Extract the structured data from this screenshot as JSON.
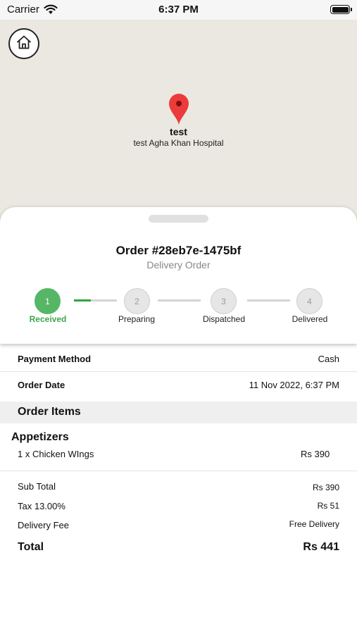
{
  "status_bar": {
    "carrier": "Carrier",
    "time": "6:37 PM"
  },
  "map": {
    "pin_title": "test",
    "pin_subtitle": "test Agha Khan Hospital",
    "pin_color": "#ec3b3b"
  },
  "order": {
    "title": "Order  #28eb7e-1475bf",
    "type": "Delivery Order"
  },
  "steps": [
    {
      "number": "1",
      "label": "Received",
      "done": true
    },
    {
      "number": "2",
      "label": "Preparing",
      "done": false
    },
    {
      "number": "3",
      "label": "Dispatched",
      "done": false
    },
    {
      "number": "4",
      "label": "Delivered",
      "done": false
    }
  ],
  "accent_color": "#55b766",
  "details": {
    "payment_label": "Payment Method",
    "payment_value": "Cash",
    "date_label": "Order Date",
    "date_value": "11 Nov 2022, 6:37 PM"
  },
  "items_section": {
    "title": "Order Items",
    "category": "Appetizers",
    "items": [
      {
        "name": "1 x Chicken WIngs",
        "price": "Rs 390"
      }
    ]
  },
  "summary": {
    "subtotal_label": "Sub Total",
    "subtotal_value": "Rs 390",
    "tax_label": "Tax 13.00%",
    "tax_value": "Rs 51",
    "delivery_label": "Delivery Fee",
    "delivery_value": "Free Delivery",
    "total_label": "Total",
    "total_value": "Rs 441"
  }
}
